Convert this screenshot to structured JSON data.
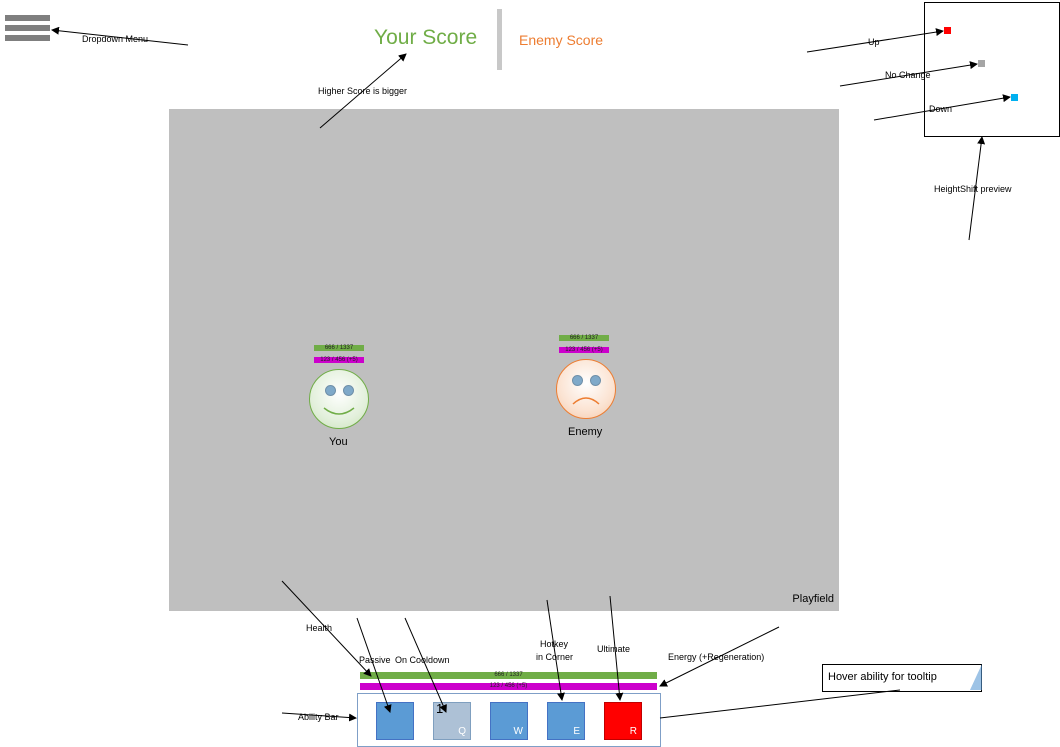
{
  "header": {
    "your_score": "Your Score",
    "enemy_score": "Enemy Score"
  },
  "playfield": {
    "label": "Playfield",
    "player": {
      "name": "You",
      "health_text": "666 / 1337",
      "energy_text": "123 / 456 (+5)"
    },
    "enemy": {
      "name": "Enemy",
      "health_text": "666 / 1337",
      "energy_text": "123 / 456 (+5)"
    }
  },
  "hud": {
    "health_text": "666 / 1337",
    "energy_text": "123 / 456 (+5)",
    "abilities": [
      {
        "hotkey": "",
        "cooldown": ""
      },
      {
        "hotkey": "Q",
        "cooldown": "1"
      },
      {
        "hotkey": "W",
        "cooldown": ""
      },
      {
        "hotkey": "E",
        "cooldown": ""
      },
      {
        "hotkey": "R",
        "cooldown": ""
      }
    ],
    "tooltip": "Hover ability for tooltip"
  },
  "colors": {
    "playfield": "#bfbfbf",
    "your_score": "#70ad47",
    "enemy_score": "#ed7d31",
    "health_bar": "#70ad47",
    "energy_bar": "#cc00cc",
    "ability": "#5b9bd5",
    "ability_cooldown": "#adc1d6",
    "ultimate": "#ff0000",
    "heightshift_up": "#ff0000",
    "heightshift_nochange": "#a5a5a5",
    "heightshift_down": "#00b0f0"
  },
  "annotations": {
    "dropdown_menu": "Dropdown Menu",
    "higher_score": "Higher Score is bigger",
    "up": "Up",
    "no_change": "No Change",
    "down": "Down",
    "heightshift_preview": "HeightShift preview",
    "health": "Health",
    "passive": "Passive",
    "on_cooldown": "On Cooldown",
    "hotkey_line1": "Hotkey",
    "hotkey_line2": "in Corner",
    "ultimate": "Ultimate",
    "energy": "Energy (+Regeneration)",
    "ability_bar": "Ability Bar"
  }
}
